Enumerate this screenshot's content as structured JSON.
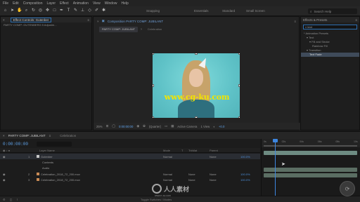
{
  "menubar": [
    "File",
    "Edit",
    "Composition",
    "Layer",
    "Effect",
    "Animation",
    "View",
    "Window",
    "Help"
  ],
  "toolbar": {
    "snapping_label": "Snapping",
    "workspaces": [
      "Essentials",
      "Standard",
      "Small Screen"
    ],
    "search_placeholder": "Search Help"
  },
  "left_panel": {
    "tab_label": "Effect Controls: Gutenber",
    "subtitle": "PARTY COMP: GUTENBERG 5 Adjustm..."
  },
  "comp_panel": {
    "header_title": "Composition PARTY COMP: JUBILANT",
    "breadcrumbs": [
      "PARTY COMP: JUBILANT",
      "Celebration"
    ],
    "watermark": "www.cg-ku.com",
    "footer": {
      "zoom": "25%",
      "timecode": "0:00:00:00",
      "quality": "(Quarter)",
      "camera": "Active Camera",
      "views": "1 View",
      "exposure": "+0.0"
    }
  },
  "right_panel": {
    "title": "Effects & Presets",
    "search_value": "text",
    "items": [
      {
        "label": "* Animation Presets",
        "selected": false
      },
      {
        "label": "▾ Text",
        "selected": false
      },
      {
        "label": "▾ Fill and Stroke",
        "selected": false
      },
      {
        "label": "Rainbow Fill",
        "selected": false
      },
      {
        "label": "▾ Transition",
        "selected": false
      },
      {
        "label": "Text Fade",
        "selected": true
      }
    ]
  },
  "timeline": {
    "tabs": [
      "PARTY COMP: JUBILANT",
      "Celebration"
    ],
    "timecode": "0:00:00:00",
    "columns": [
      "Layer Name",
      "Mode",
      "T",
      "TrkMat",
      "Parent"
    ],
    "rows": [
      {
        "num": "1",
        "name": "Gutenber",
        "mode": "Normal",
        "trkmat": "",
        "parent": "None",
        "stretch": "100.0%",
        "color": "#c8c8c8"
      },
      {
        "num": "",
        "name": "Contents",
        "mode": "",
        "trkmat": "",
        "parent": "",
        "stretch": "",
        "color": ""
      },
      {
        "num": "",
        "name": "Audio",
        "mode": "",
        "trkmat": "",
        "parent": "",
        "stretch": "",
        "color": ""
      },
      {
        "num": "2",
        "name": "Celebration_2018_72_200.mov",
        "mode": "Normal",
        "trkmat": "None",
        "parent": "None",
        "stretch": "100.0%",
        "color": "#c98a55"
      },
      {
        "num": "3",
        "name": "Celebration_2018_72_200.mov",
        "mode": "Normal",
        "trkmat": "None",
        "parent": "None",
        "stretch": "100.0%",
        "color": "#c98a55"
      }
    ],
    "ruler_ticks": [
      "0s",
      "02s",
      "04s",
      "06s",
      "08s",
      "10s"
    ],
    "footer_toggle": "Toggle Switches / Modes"
  },
  "branding": {
    "logo_text": "人人素材",
    "url": "www.rr-sc.com"
  },
  "colors": {
    "accent_blue": "#3d86e0",
    "canvas_bg": "#67c8cc",
    "watermark": "#f2e400"
  }
}
